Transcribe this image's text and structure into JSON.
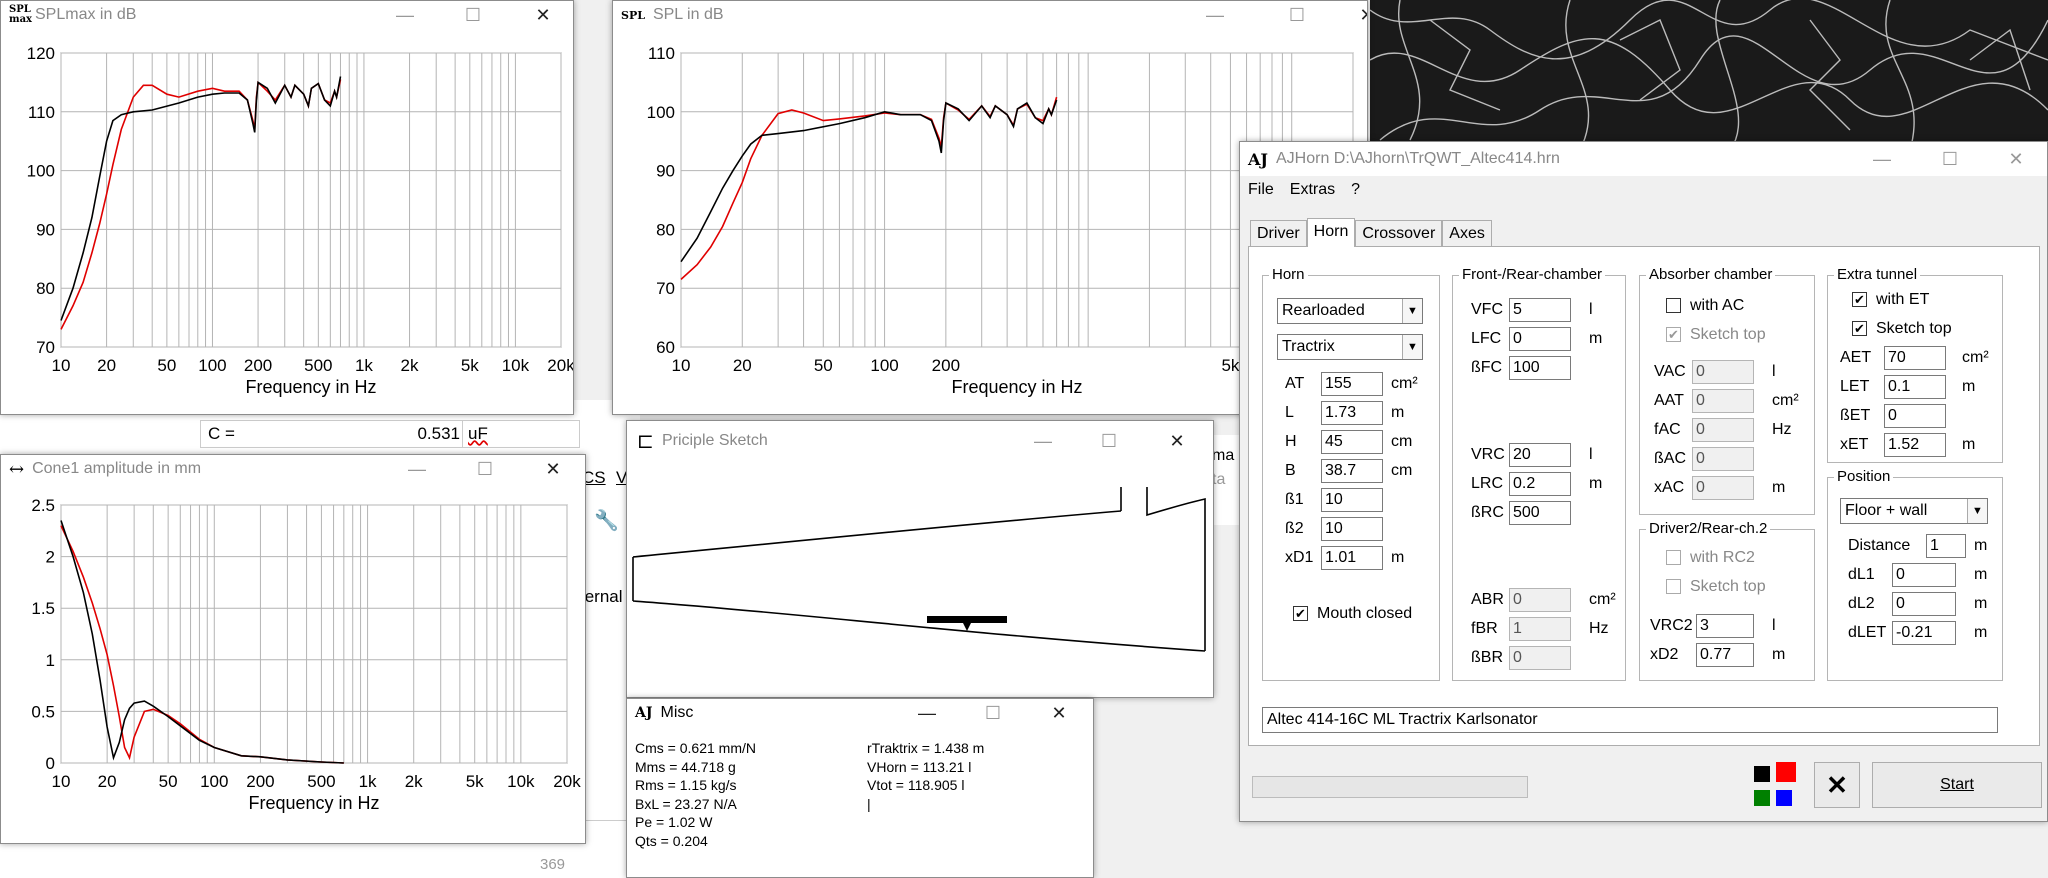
{
  "splmax_window": {
    "title": "SPLmax in dB",
    "icon": "SPL max",
    "chart_data": {
      "type": "line",
      "title": "SPLmax in dB",
      "xlabel": "Frequency in Hz",
      "ylabel": "",
      "x_scale": "log",
      "xlim": [
        10,
        20000
      ],
      "ylim": [
        70,
        120
      ],
      "xticks": [
        "10",
        "20",
        "50",
        "100",
        "200",
        "500",
        "1k",
        "2k",
        "5k",
        "10k",
        "20k"
      ],
      "yticks": [
        "120",
        "110",
        "100",
        "90",
        "80",
        "70"
      ],
      "series": [
        {
          "color": "#000000",
          "x": [
            10,
            12,
            14,
            16,
            18,
            20,
            22,
            25,
            30,
            40,
            60,
            80,
            100,
            120,
            150,
            170,
            185,
            190,
            195,
            200,
            230,
            260,
            300,
            330,
            350,
            400,
            430,
            450,
            500,
            550,
            600,
            640,
            660,
            700
          ],
          "y": [
            74.5,
            80,
            86,
            92,
            99,
            105,
            108.5,
            109.5,
            110,
            110.3,
            111.5,
            112.5,
            113,
            113.2,
            113.2,
            112,
            108,
            106.5,
            112,
            115,
            114,
            111.5,
            114.5,
            112.5,
            114.5,
            113,
            111,
            114,
            114.8,
            112,
            111,
            113.5,
            112.5,
            116
          ]
        },
        {
          "color": "#e00000",
          "x": [
            10,
            12,
            14,
            16,
            18,
            20,
            22,
            25,
            30,
            35,
            40,
            50,
            60,
            80,
            100,
            120,
            150,
            170,
            185,
            190,
            195,
            200,
            230,
            260,
            300,
            330,
            350,
            400,
            430,
            450,
            500,
            550,
            600,
            640,
            660,
            700
          ],
          "y": [
            73,
            77,
            81,
            86,
            91,
            96,
            101,
            107,
            112.5,
            114.5,
            114.5,
            113,
            112.5,
            113.5,
            114,
            113.5,
            113.5,
            112,
            108.5,
            107,
            112.5,
            115,
            113.5,
            112,
            114.5,
            112.5,
            114.5,
            113,
            111,
            114,
            114.8,
            112,
            111.5,
            113.5,
            112.5,
            115.5
          ]
        }
      ]
    }
  },
  "spl_window": {
    "title": "SPL in dB",
    "icon": "SPL",
    "chart_data": {
      "type": "line",
      "title": "SPL in dB",
      "xlabel": "Frequency in Hz",
      "ylabel": "",
      "x_scale": "log",
      "xlim": [
        10,
        20000
      ],
      "ylim": [
        60,
        110
      ],
      "xticks": [
        "10",
        "20",
        "50",
        "100",
        "200",
        "5k"
      ],
      "yticks": [
        "110",
        "100",
        "90",
        "80",
        "70",
        "60"
      ],
      "series": [
        {
          "color": "#000000",
          "x": [
            10,
            12,
            14,
            16,
            18,
            20,
            22,
            25,
            30,
            40,
            60,
            80,
            100,
            120,
            150,
            170,
            185,
            190,
            195,
            200,
            230,
            260,
            300,
            330,
            350,
            400,
            430,
            450,
            500,
            550,
            600,
            640,
            660,
            700
          ],
          "y": [
            74.5,
            78.5,
            83,
            87,
            90,
            92.5,
            94.5,
            96,
            96.3,
            96.8,
            98,
            99,
            100,
            99.5,
            99.5,
            98.5,
            95,
            93,
            98.5,
            101.5,
            100.5,
            98.5,
            101,
            99,
            101,
            99.5,
            97.5,
            100.5,
            101.5,
            99,
            98,
            100.5,
            99.5,
            102
          ]
        },
        {
          "color": "#e00000",
          "x": [
            10,
            12,
            14,
            16,
            18,
            20,
            22,
            25,
            30,
            35,
            40,
            50,
            60,
            80,
            100,
            120,
            150,
            170,
            185,
            190,
            195,
            200,
            230,
            260,
            300,
            330,
            350,
            400,
            430,
            450,
            500,
            550,
            600,
            640,
            660,
            700
          ],
          "y": [
            71.5,
            74,
            77,
            80.5,
            84.5,
            88,
            92,
            96,
            99.7,
            100.3,
            99.8,
            98.5,
            98.8,
            99.3,
            99.8,
            99.5,
            99.5,
            98.7,
            95.5,
            94,
            99,
            101.5,
            100.3,
            98.7,
            101,
            99.2,
            101,
            99.5,
            97.7,
            100.5,
            101.3,
            99,
            98.5,
            100.5,
            99.5,
            102.5
          ]
        }
      ]
    }
  },
  "cone_window": {
    "title": "Cone1 amplitude in mm",
    "icon": "↔",
    "chart_data": {
      "type": "line",
      "title": "Cone1 amplitude in mm",
      "xlabel": "Frequency in Hz",
      "ylabel": "",
      "x_scale": "log",
      "xlim": [
        10,
        20000
      ],
      "ylim": [
        0,
        2.5
      ],
      "xticks": [
        "10",
        "20",
        "50",
        "100",
        "200",
        "500",
        "1k",
        "2k",
        "5k",
        "10k",
        "20k"
      ],
      "yticks": [
        "2.5",
        "2",
        "1.5",
        "1",
        "0.5",
        "0"
      ],
      "series": [
        {
          "color": "#000000",
          "x": [
            10,
            12,
            14,
            16,
            18,
            20,
            22,
            24,
            26,
            28,
            30,
            35,
            40,
            50,
            60,
            80,
            100,
            150,
            200,
            300,
            500,
            700
          ],
          "y": [
            2.35,
            2.0,
            1.65,
            1.25,
            0.8,
            0.35,
            0.05,
            0.2,
            0.42,
            0.53,
            0.58,
            0.6,
            0.55,
            0.45,
            0.36,
            0.22,
            0.15,
            0.07,
            0.06,
            0.03,
            0.01,
            0.0
          ]
        },
        {
          "color": "#e00000",
          "x": [
            10,
            12,
            14,
            16,
            18,
            20,
            22,
            24,
            26,
            28,
            30,
            35,
            40,
            50,
            60,
            80,
            100,
            150,
            200,
            300,
            500,
            700
          ],
          "y": [
            2.3,
            2.05,
            1.8,
            1.55,
            1.3,
            1.05,
            0.75,
            0.45,
            0.15,
            0.05,
            0.25,
            0.5,
            0.52,
            0.46,
            0.38,
            0.23,
            0.15,
            0.07,
            0.06,
            0.03,
            0.01,
            0.0
          ]
        }
      ]
    }
  },
  "sketch_window": {
    "title": "Priciple Sketch"
  },
  "misc_window": {
    "title": "Misc",
    "left_lines": [
      "Cms = 0.621 mm/N",
      "Mms = 44.718 g",
      "Rms = 1.15 kg/s",
      "BxL = 23.27 N/A",
      "Pe = 1.02 W",
      "Qts = 0.204"
    ],
    "right_lines": [
      "rTraktrix = 1.438 m",
      "VHorn = 113.21 l",
      "Vtot = 118.905 l",
      "|"
    ]
  },
  "background": {
    "formula_label": "C =",
    "formula_value": "0.531",
    "formula_unit": "uF",
    "cut_text_1": "CS",
    "cut_text_2": "V",
    "cut_text_3": "ternal",
    "cut_text_4": "ma",
    "cut_text_5": "ta",
    "page_number": "369"
  },
  "ajhorn": {
    "title": "AJHorn  D:\\AJhorn\\TrQWT_Altec414.hrn",
    "menu": [
      "File",
      "Extras",
      "?"
    ],
    "tabs": [
      "Driver",
      "Horn",
      "Crossover",
      "Axes"
    ],
    "horn_group": {
      "title": "Horn",
      "type_select": "Rearloaded",
      "profile_select": "Tractrix",
      "fields": [
        {
          "label": "AT",
          "value": "155",
          "unit": "cm²"
        },
        {
          "label": "L",
          "value": "1.73",
          "unit": "m"
        },
        {
          "label": "H",
          "value": "45",
          "unit": "cm"
        },
        {
          "label": "B",
          "value": "38.7",
          "unit": "cm"
        },
        {
          "label": "ß1",
          "value": "10",
          "unit": ""
        },
        {
          "label": "ß2",
          "value": "10",
          "unit": ""
        },
        {
          "label": "xD1",
          "value": "1.01",
          "unit": "m"
        }
      ],
      "mouth_closed": "Mouth closed"
    },
    "chamber_group": {
      "title": "Front-/Rear-chamber",
      "front": [
        {
          "label": "VFC",
          "value": "5",
          "unit": "l"
        },
        {
          "label": "LFC",
          "value": "0",
          "unit": "m"
        },
        {
          "label": "ßFC",
          "value": "100",
          "unit": ""
        }
      ],
      "rear": [
        {
          "label": "VRC",
          "value": "20",
          "unit": "l"
        },
        {
          "label": "LRC",
          "value": "0.2",
          "unit": "m"
        },
        {
          "label": "ßRC",
          "value": "500",
          "unit": ""
        }
      ],
      "br": [
        {
          "label": "ABR",
          "value": "0",
          "unit": "cm²"
        },
        {
          "label": "fBR",
          "value": "1",
          "unit": "Hz"
        },
        {
          "label": "ßBR",
          "value": "0",
          "unit": ""
        }
      ]
    },
    "absorber_group": {
      "title": "Absorber chamber",
      "with_ac": "with AC",
      "sketch_top": "Sketch top",
      "fields": [
        {
          "label": "VAC",
          "value": "0",
          "unit": "l"
        },
        {
          "label": "AAT",
          "value": "0",
          "unit": "cm²"
        },
        {
          "label": "fAC",
          "value": "0",
          "unit": "Hz"
        },
        {
          "label": "ßAC",
          "value": "0",
          "unit": ""
        },
        {
          "label": "xAC",
          "value": "0",
          "unit": "m"
        }
      ]
    },
    "driver2_group": {
      "title": "Driver2/Rear-ch.2",
      "with_rc2": "with RC2",
      "sketch_top": "Sketch top",
      "fields": [
        {
          "label": "VRC2",
          "value": "3",
          "unit": "l"
        },
        {
          "label": "xD2",
          "value": "0.77",
          "unit": "m"
        }
      ]
    },
    "tunnel_group": {
      "title": "Extra tunnel",
      "with_et": "with ET",
      "sketch_top": "Sketch top",
      "fields": [
        {
          "label": "AET",
          "value": "70",
          "unit": "cm²"
        },
        {
          "label": "LET",
          "value": "0.1",
          "unit": "m"
        },
        {
          "label": "ßET",
          "value": "0",
          "unit": ""
        },
        {
          "label": "xET",
          "value": "1.52",
          "unit": "m"
        }
      ]
    },
    "position_group": {
      "title": "Position",
      "select": "Floor + wall",
      "fields": [
        {
          "label": "Distance",
          "value": "1",
          "unit": "m"
        },
        {
          "label": "dL1",
          "value": "0",
          "unit": "m"
        },
        {
          "label": "dL2",
          "value": "0",
          "unit": "m"
        },
        {
          "label": "dLET",
          "value": "-0.21",
          "unit": "m"
        }
      ]
    },
    "description": "Altec 414-16C ML Tractrix Karlsonator",
    "start_label": "Start",
    "colors": [
      "#000000",
      "#ff0000",
      "#008000",
      "#0000ff"
    ]
  }
}
